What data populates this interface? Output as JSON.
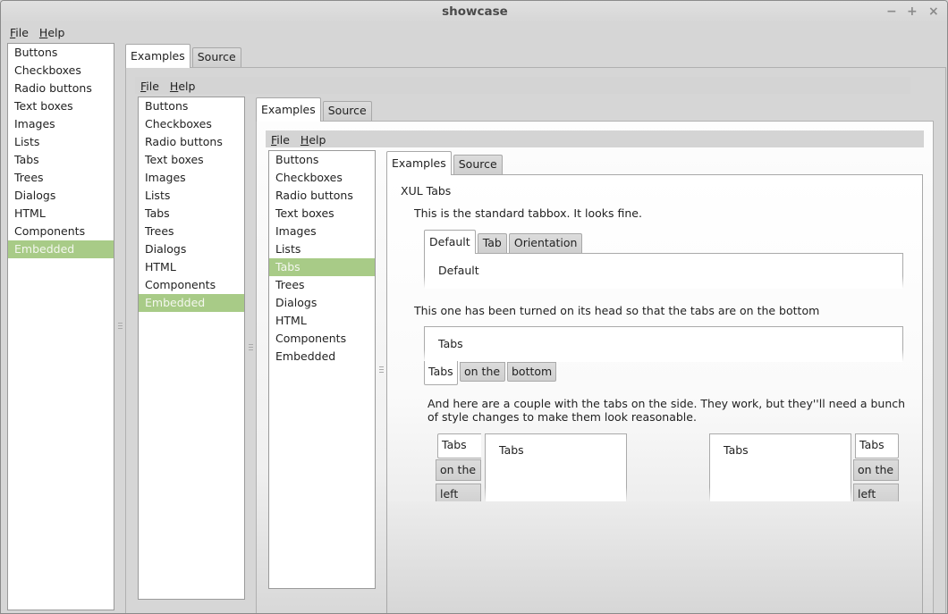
{
  "window": {
    "title": "showcase",
    "controls": {
      "minimize": "−",
      "maximize": "+",
      "close": "×"
    }
  },
  "menu": {
    "file": {
      "accel": "F",
      "rest": "ile"
    },
    "help": {
      "accel": "H",
      "rest": "elp"
    }
  },
  "nav_items": [
    "Buttons",
    "Checkboxes",
    "Radio buttons",
    "Text boxes",
    "Images",
    "Lists",
    "Tabs",
    "Trees",
    "Dialogs",
    "HTML",
    "Components",
    "Embedded"
  ],
  "level1": {
    "selected": "Embedded",
    "tabs": [
      "Examples",
      "Source"
    ],
    "active_tab": "Examples"
  },
  "level2": {
    "selected": "Embedded",
    "tabs": [
      "Examples",
      "Source"
    ],
    "active_tab": "Examples"
  },
  "level3": {
    "selected": "Tabs",
    "tabs": [
      "Examples",
      "Source"
    ],
    "active_tab": "Examples"
  },
  "content": {
    "heading": "XUL Tabs",
    "intro": "This is the standard tabbox. It looks fine.",
    "standard": {
      "tabs": [
        "Default",
        "Tab",
        "Orientation"
      ],
      "active_tab": "Default",
      "panel_text": "Default"
    },
    "bottom_desc": "This one has been turned on its head so that the tabs are on the bottom",
    "bottom": {
      "tabs": [
        "Tabs",
        "on the",
        "bottom"
      ],
      "active_tab": "Tabs",
      "panel_text": "Tabs"
    },
    "side_desc_line1": "And here are a couple with the tabs on the side. They work, but they''ll need a bunch",
    "side_desc_line2": "of style changes to make them look reasonable.",
    "left": {
      "tabs": [
        "Tabs",
        "on the",
        "left"
      ],
      "active_tab": "Tabs",
      "panel_text": "Tabs"
    },
    "right": {
      "tabs": [
        "Tabs",
        "on the",
        "left"
      ],
      "active_tab": "Tabs",
      "panel_text": "Tabs"
    }
  },
  "colors": {
    "selection": "#a8cb87",
    "window_bg": "#d6d6d6"
  }
}
